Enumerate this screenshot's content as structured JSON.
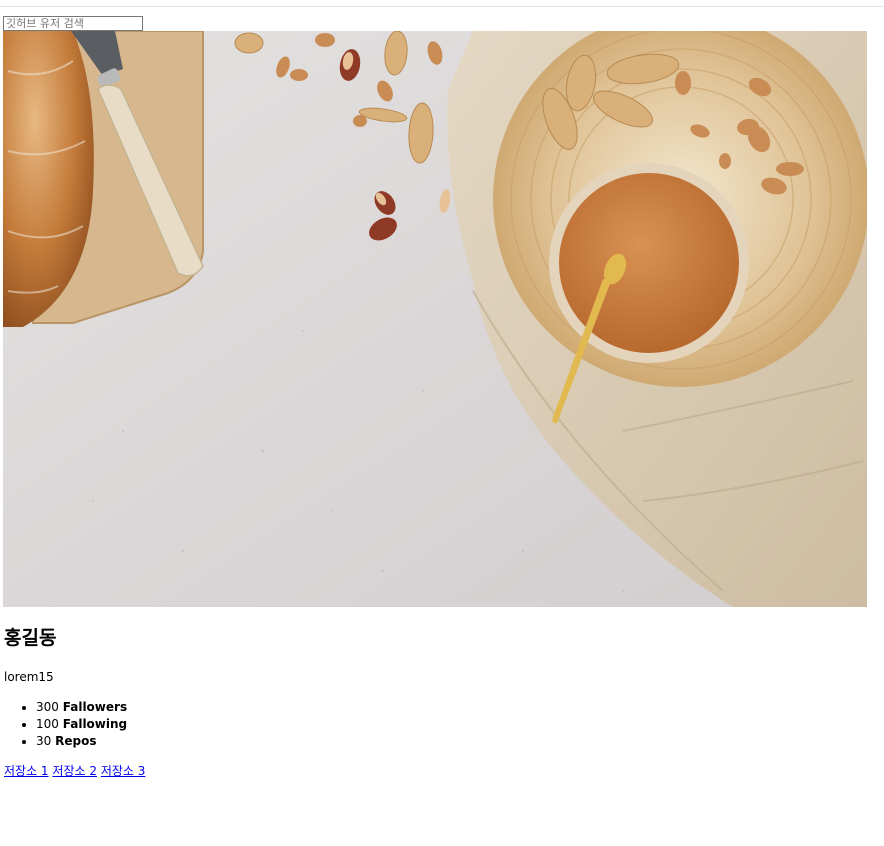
{
  "search": {
    "placeholder": "깃허브 유저 검색",
    "value": ""
  },
  "profile": {
    "name": "홍길동",
    "bio": "lorem15",
    "stats": [
      {
        "value": "300",
        "label": "Fallowers"
      },
      {
        "value": "100",
        "label": "Fallowing"
      },
      {
        "value": "30",
        "label": "Repos"
      }
    ]
  },
  "repos": [
    {
      "label": "저장소 1"
    },
    {
      "label": "저장소 2"
    },
    {
      "label": "저장소 3"
    }
  ],
  "colors": {
    "link": "#0000ee",
    "background": "#ffffff",
    "text": "#000000"
  }
}
